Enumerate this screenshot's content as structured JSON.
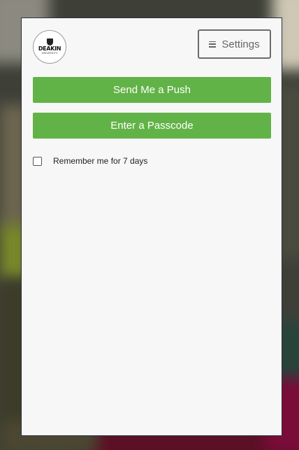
{
  "header": {
    "logo": {
      "word": "DEAKIN",
      "subword": "UNIVERSITY",
      "icon": "crest-icon"
    },
    "settings": {
      "label": "Settings",
      "icon": "hamburger-menu-icon"
    }
  },
  "auth": {
    "push_label": "Send Me a Push",
    "passcode_label": "Enter a Passcode",
    "remember_label": "Remember me for 7 days",
    "remember_checked": false
  },
  "colors": {
    "accent_green": "#62b347",
    "panel_bg": "#f7f7f7",
    "settings_border": "#6b6b6b"
  }
}
